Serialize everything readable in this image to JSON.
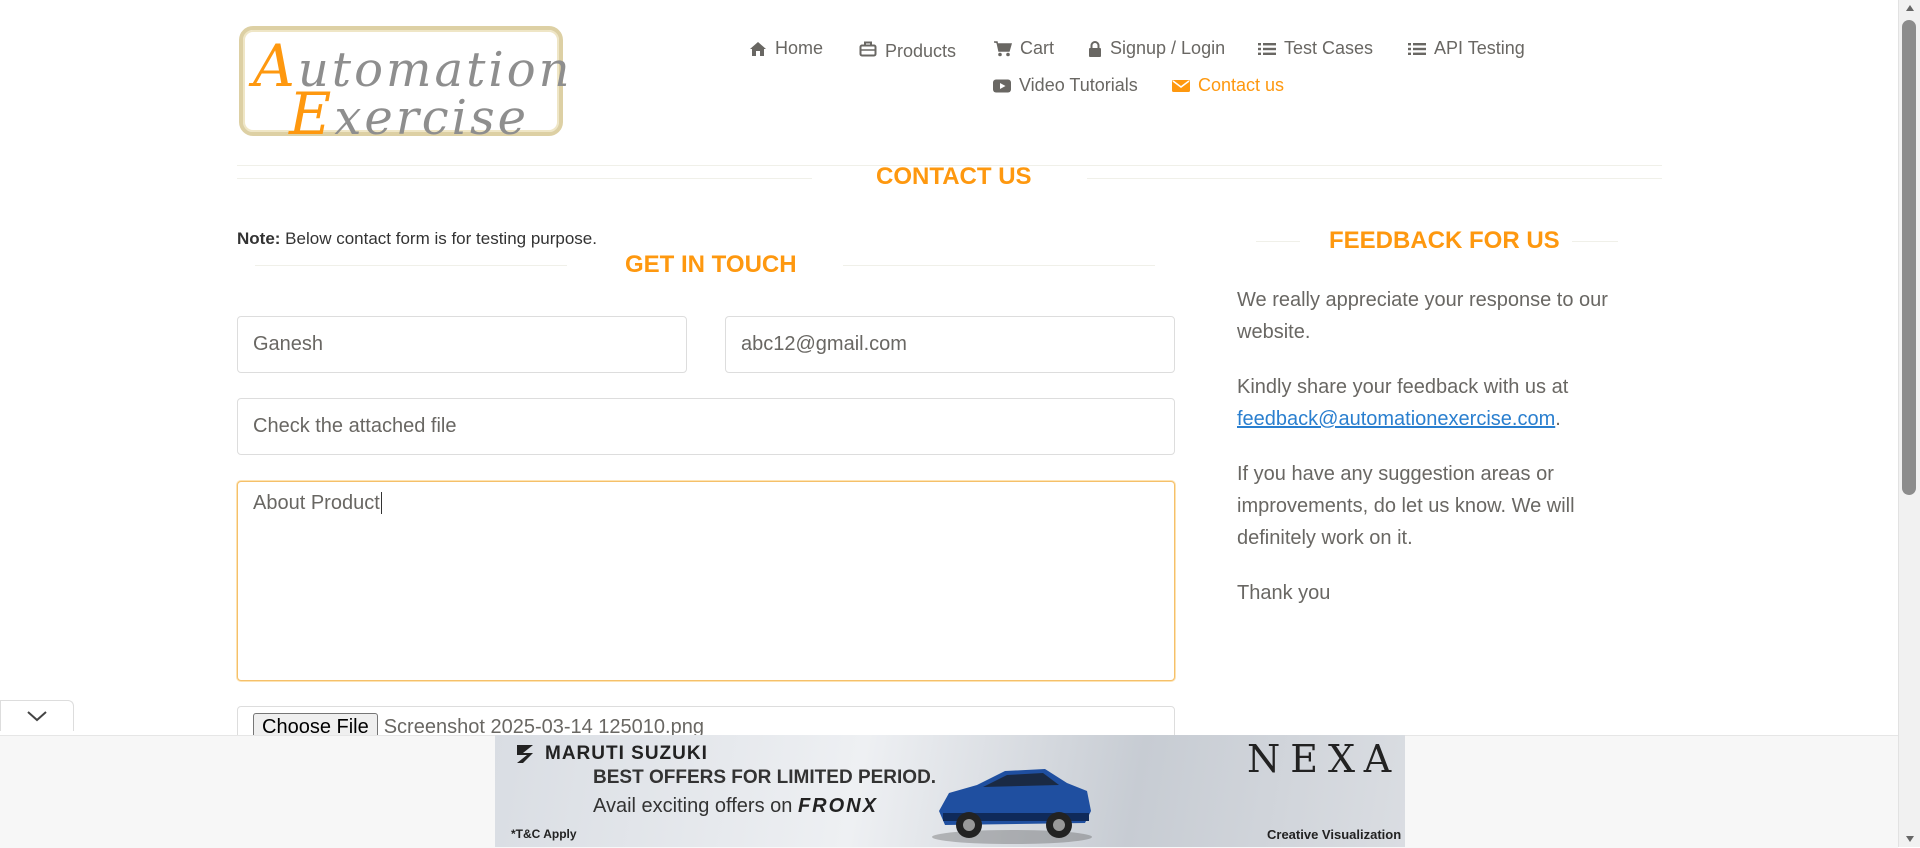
{
  "logo": {
    "line1_cap": "A",
    "line1_rest": "utomation",
    "line2_cap": "E",
    "line2_rest": "xercise"
  },
  "nav": {
    "row1": [
      {
        "label": "Home",
        "icon": "home-icon"
      },
      {
        "label": "Products",
        "icon": "briefcase-icon"
      },
      {
        "label": "Cart",
        "icon": "cart-icon"
      },
      {
        "label": "Signup / Login",
        "icon": "lock-icon"
      },
      {
        "label": "Test Cases",
        "icon": "list-icon"
      },
      {
        "label": "API Testing",
        "icon": "list-icon"
      }
    ],
    "row2": [
      {
        "label": "Video Tutorials",
        "icon": "youtube-play-icon"
      },
      {
        "label": "Contact us",
        "icon": "envelope-icon",
        "active": true
      }
    ]
  },
  "colors": {
    "accent": "#fe980f",
    "text": "#696763",
    "link": "#2a7fcf"
  },
  "contact": {
    "title": "CONTACT US",
    "note_bold": "Note:",
    "note_text": " Below contact form is for testing purpose.",
    "get_in_touch": "GET IN TOUCH",
    "form": {
      "name_value": "Ganesh",
      "email_value": "abc12@gmail.com",
      "subject_value": "Check the attached file",
      "message_value": "About Product",
      "file_button": "Choose File",
      "file_name": "Screenshot 2025-03-14 125010.png"
    }
  },
  "feedback": {
    "title": "FEEDBACK FOR US",
    "p1": "We really appreciate your response to our website.",
    "p2_text": "Kindly share your feedback with us at ",
    "p2_link": "feedback@automationexercise.com",
    "p2_end": ".",
    "p3": "If you have any suggestion areas or improvements, do let us know. We will definitely work on it.",
    "p4": "Thank you"
  },
  "ad": {
    "brand": "MARUTI SUZUKI",
    "headline": "BEST OFFERS FOR LIMITED PERIOD.",
    "subline_prefix": "Avail exciting offers on ",
    "subline_model": "FRONX",
    "tc": "*T&C Apply",
    "nexa": "NEXA",
    "credit": "Creative Visualization"
  }
}
